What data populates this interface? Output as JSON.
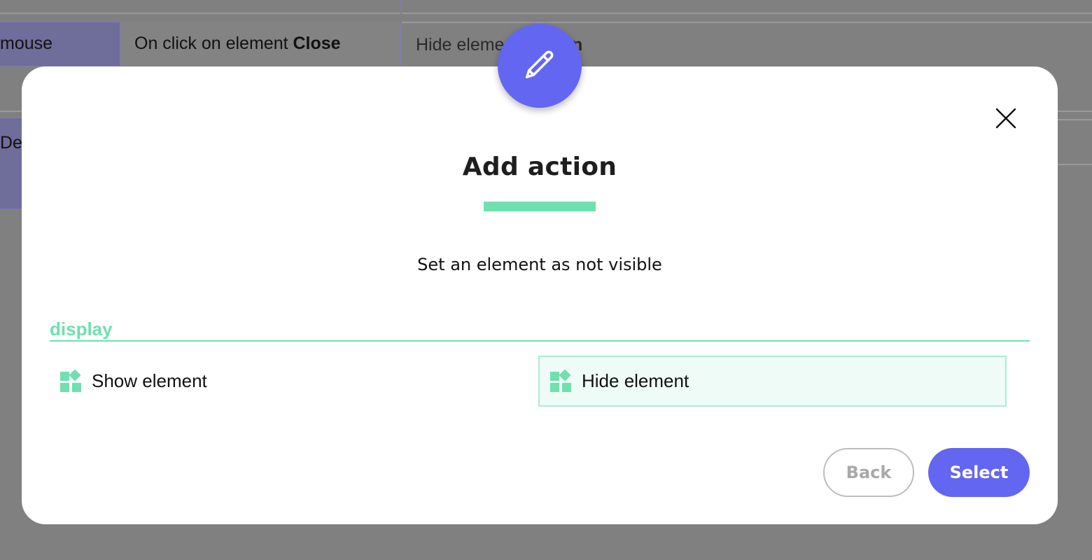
{
  "background": {
    "row1_trigger_prefix": "mouse",
    "row1_event_text": "On click on element ",
    "row1_event_bold": "Close",
    "row1_action_text": "Hide eleme",
    "row1_action_tail": "n",
    "row2_trigger_prefix": "Dev"
  },
  "modal": {
    "header_icon": "pencil-icon",
    "title": "Add action",
    "subtitle": "Set an element as not visible",
    "section_label": "display",
    "options": [
      {
        "label": "Show element",
        "icon": "widgets-icon",
        "selected": false
      },
      {
        "label": "Hide element",
        "icon": "widgets-icon",
        "selected": true
      }
    ],
    "back_label": "Back",
    "select_label": "Select"
  },
  "colors": {
    "accent": "#6366f1",
    "green": "#6fe0ae",
    "selected_bg": "#effbf6"
  }
}
